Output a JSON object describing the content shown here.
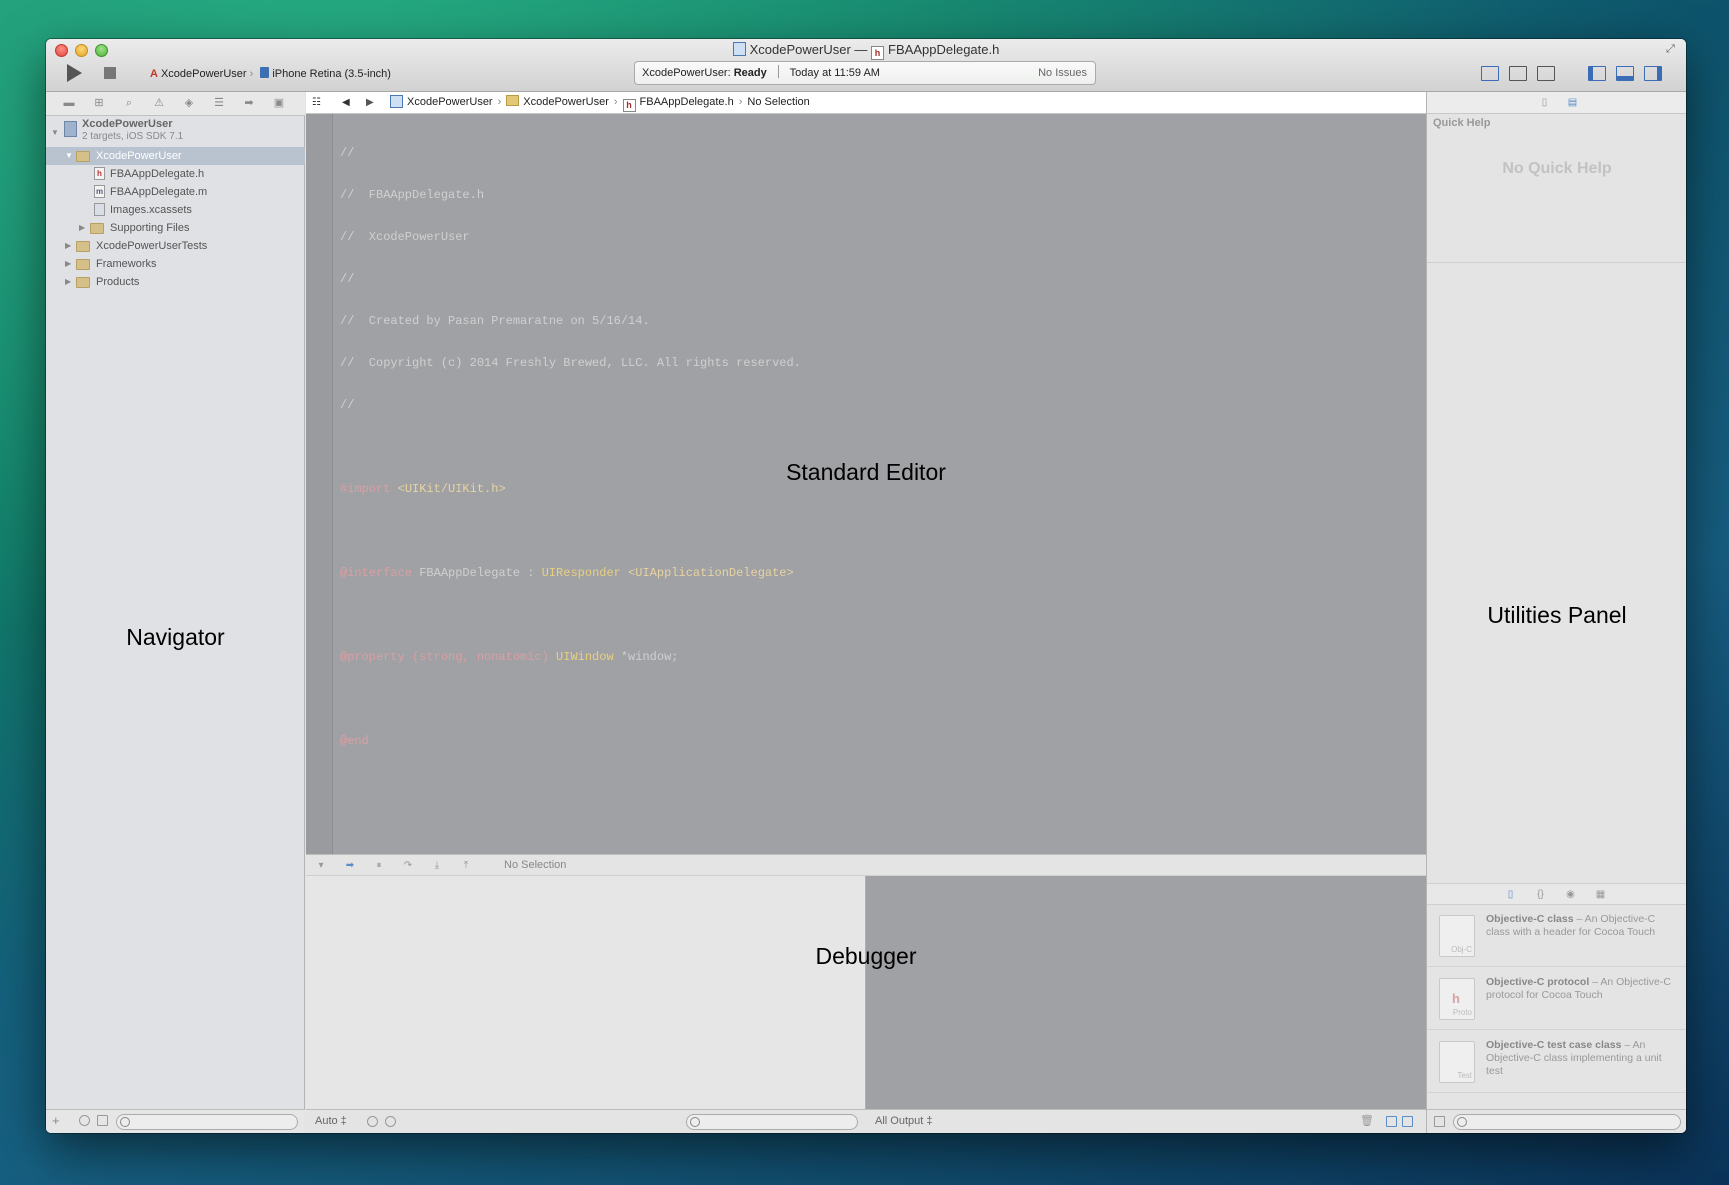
{
  "window": {
    "title_project": "XcodePowerUser",
    "title_sep": "—",
    "title_file": "FBAAppDelegate.h"
  },
  "toolbar": {
    "scheme": "XcodePowerUser",
    "device": "iPhone Retina (3.5-inch)",
    "activity_project": "XcodePowerUser:",
    "activity_status": "Ready",
    "activity_time": "Today at 11:59 AM",
    "activity_issues": "No Issues"
  },
  "navigator": {
    "label": "Navigator",
    "project_name": "XcodePowerUser",
    "project_sub": "2 targets, iOS SDK 7.1",
    "group_selected": "XcodePowerUser",
    "files": [
      "FBAAppDelegate.h",
      "FBAAppDelegate.m",
      "Images.xcassets"
    ],
    "supporting": "Supporting Files",
    "groups": [
      "XcodePowerUserTests",
      "Frameworks",
      "Products"
    ]
  },
  "jumpbar": {
    "crumb1": "XcodePowerUser",
    "crumb2": "XcodePowerUser",
    "crumb3": "FBAAppDelegate.h",
    "crumb4": "No Selection"
  },
  "editor": {
    "label": "Standard Editor",
    "c1": "//",
    "c2": "//  FBAAppDelegate.h",
    "c3": "//  XcodePowerUser",
    "c4": "//",
    "c5": "//  Created by Pasan Premaratne on 5/16/14.",
    "c6": "//  Copyright (c) 2014 Freshly Brewed, LLC. All rights reserved.",
    "c7": "//",
    "import_kw": "#import",
    "import_str": "<UIKit/UIKit.h>",
    "iface_kw": "@interface",
    "iface_name": "FBAAppDelegate",
    "iface_colon": ":",
    "iface_super": "UIResponder",
    "iface_proto": "<UIApplicationDelegate>",
    "prop_kw": "@property",
    "prop_attrs": "(strong, nonatomic)",
    "prop_type": "UIWindow",
    "prop_var": "*window;",
    "end_kw": "@end"
  },
  "debugger": {
    "label": "Debugger",
    "bar_text": "No Selection",
    "auto_label": "Auto ‡",
    "output_label": "All Output ‡"
  },
  "utilities": {
    "label": "Utilities Panel",
    "quick_help_title": "Quick Help",
    "no_quick_help": "No Quick Help",
    "library": [
      {
        "title": "Objective-C class",
        "desc": " – An Objective-C class with a header for Cocoa Touch",
        "badge": "Obj-C"
      },
      {
        "title": "Objective-C protocol",
        "desc": " – An Objective-C protocol for Cocoa Touch",
        "badge": "Proto"
      },
      {
        "title": "Objective-C test case class",
        "desc": " – An Objective-C class implementing a unit test",
        "badge": "Test"
      }
    ]
  }
}
